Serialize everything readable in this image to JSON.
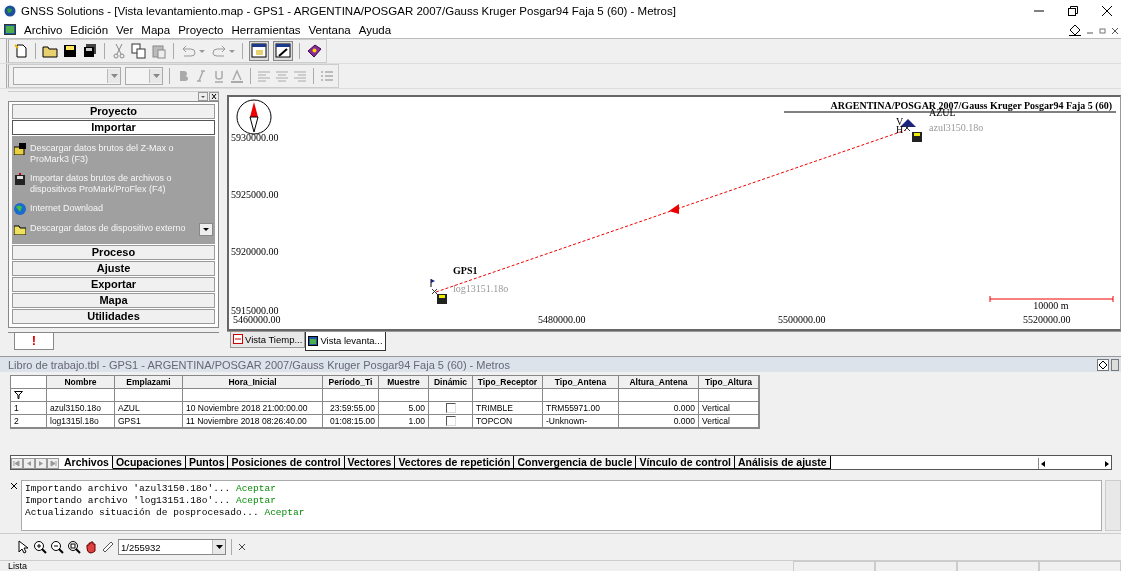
{
  "window": {
    "title": "GNSS Solutions - [Vista levantamiento.map - GPS1 - ARGENTINA/POSGAR 2007/Gauss Kruger Posgar94 Faja 5 (60) - Metros]"
  },
  "menu": [
    "Archivo",
    "Edición",
    "Ver",
    "Mapa",
    "Proyecto",
    "Herramientas",
    "Ventana",
    "Ayuda"
  ],
  "sidebar": {
    "sections": [
      {
        "label": "Proyecto",
        "expanded": false
      },
      {
        "label": "Importar",
        "expanded": true,
        "items": [
          "Descargar datos brutos del Z-Max o ProMark3 (F3)",
          "Importar datos brutos de archivos o dispositivos ProMark/ProFlex (F4)",
          "Internet Download",
          "Descargar datos de dispositivo externo"
        ]
      },
      {
        "label": "Proceso",
        "expanded": false
      },
      {
        "label": "Ajuste",
        "expanded": false
      },
      {
        "label": "Exportar",
        "expanded": false
      },
      {
        "label": "Mapa",
        "expanded": false
      },
      {
        "label": "Utilidades",
        "expanded": false
      }
    ],
    "tab": "!"
  },
  "map": {
    "projection": "ARGENTINA/POSGAR 2007/Gauss Kruger Posgar94 Faja 5 (60)",
    "y_labels": [
      "5930000.00",
      "5925000.00",
      "5920000.00",
      "5915000.00"
    ],
    "x_labels": [
      "5460000.00",
      "5480000.00",
      "5500000.00",
      "5520000.00"
    ],
    "points": [
      {
        "name": "AZUL",
        "file": "azul3150.18o",
        "marks": [
          "V",
          "H"
        ]
      },
      {
        "name": "GPS1",
        "file": "log13151.18o"
      }
    ],
    "scale": "10000 m"
  },
  "map_tabs": [
    {
      "label": "Vista Tiemp...",
      "selected": false
    },
    {
      "label": "Vista levanta...",
      "selected": true
    }
  ],
  "workbook": {
    "title": "Libro de trabajo.tbl - GPS1 - ARGENTINA/POSGAR 2007/Gauss Kruger Posgar94 Faja 5 (60) - Metros",
    "columns": [
      "Nombre",
      "Emplazami",
      "Hora_Inicial",
      "Período_Ti",
      "Muestre",
      "Dinámic",
      "Tipo_Receptor",
      "Tipo_Antena",
      "Altura_Antena",
      "Tipo_Altura"
    ],
    "rows": [
      {
        "num": "1",
        "cells": [
          "azul3150.18o",
          "AZUL",
          "10 Noviembre 2018 21:00:00.00",
          "23:59:55.00",
          "5.00"
        ],
        "dynamic": false,
        "rest": [
          "TRIMBLE",
          "TRM55971.00",
          "0.000",
          "Vertical"
        ]
      },
      {
        "num": "2",
        "cells": [
          "log1315l.18o",
          "GPS1",
          "11 Noviembre 2018 08:26:40.00",
          "01:08:15.00",
          "1.00"
        ],
        "dynamic": false,
        "rest": [
          "TOPCON",
          "-Unknown-",
          "0.000",
          "Vertical"
        ]
      }
    ]
  },
  "sheet_tabs": [
    {
      "label": "Archivos",
      "selected": true
    },
    {
      "label": "Ocupaciones",
      "selected": false
    },
    {
      "label": "Puntos",
      "selected": false
    },
    {
      "label": "Posiciones de control",
      "selected": false
    },
    {
      "label": "Vectores",
      "selected": false
    },
    {
      "label": "Vectores de repetición",
      "selected": false
    },
    {
      "label": "Convergencia de bucle",
      "selected": false
    },
    {
      "label": "Vínculo de control",
      "selected": false
    },
    {
      "label": "Análisis de ajuste",
      "selected": false
    }
  ],
  "log": [
    {
      "text": "Importando archivo 'azul3150.18o'...",
      "result": "Aceptar"
    },
    {
      "text": "Importando archivo 'log13151.18o'...",
      "result": "Aceptar"
    },
    {
      "text": "Actualizando situación de posprocesado...",
      "result": "Aceptar"
    }
  ],
  "zoom_field": {
    "value": "1/255932"
  },
  "status_bar": "Lista"
}
